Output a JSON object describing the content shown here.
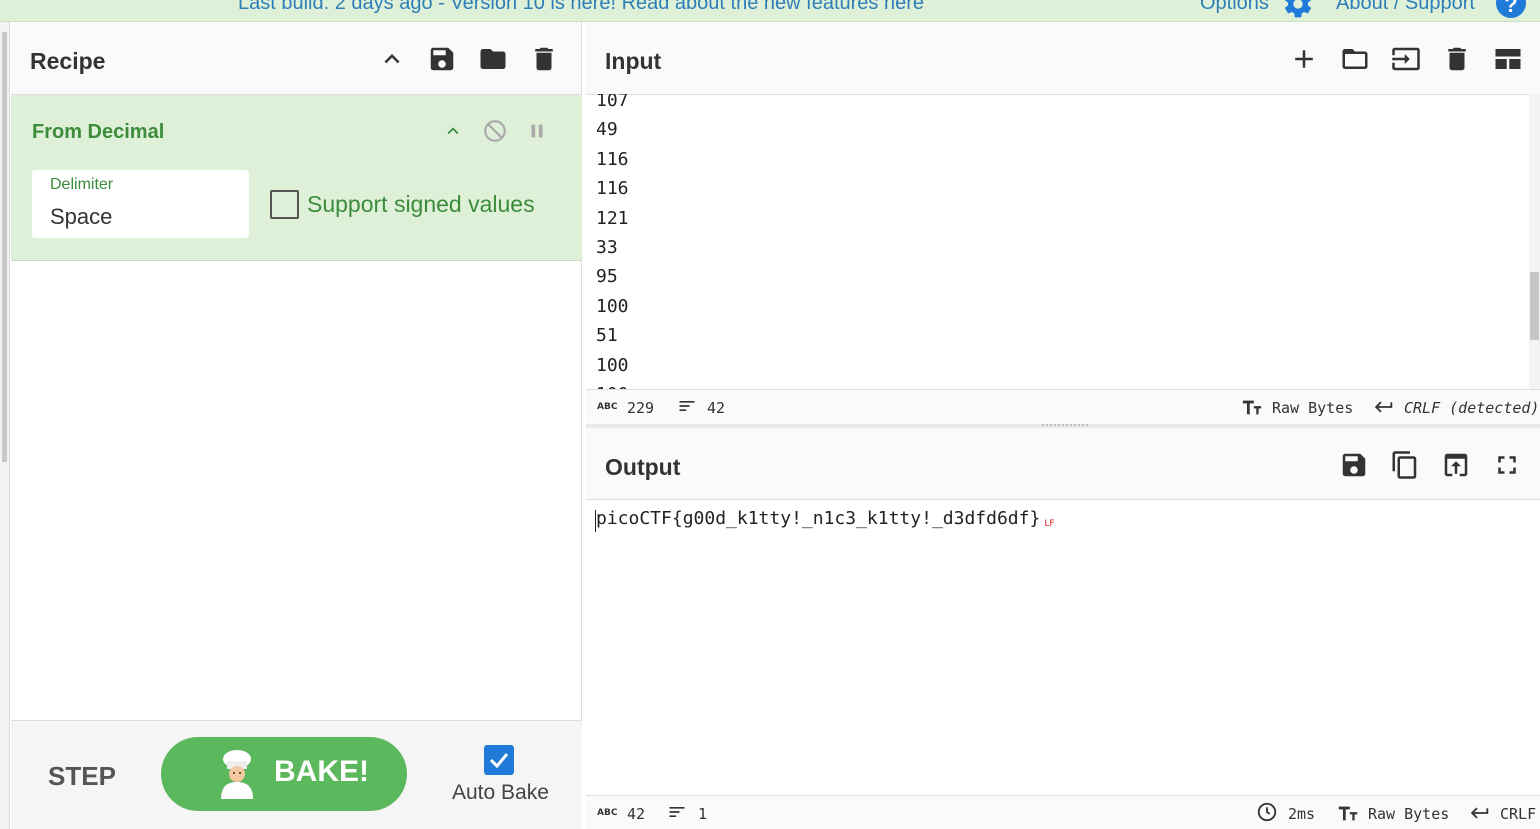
{
  "banner": {
    "message": "Last build: 2 days ago - Version 10 is here! Read about the new features ",
    "link": "here",
    "options": "Options",
    "about": "About / Support",
    "help_glyph": "?"
  },
  "recipe": {
    "title": "Recipe",
    "operation": {
      "name": "From Decimal",
      "delimiter_label": "Delimiter",
      "delimiter_value": "Space",
      "checkbox_label": "Support signed values"
    },
    "step_label": "STEP",
    "bake_label": "BAKE!",
    "autobake_label": "Auto Bake"
  },
  "input": {
    "title": "Input",
    "lines": [
      "107",
      "49",
      "116",
      "116",
      "121",
      "33",
      "95",
      "100",
      "51",
      "100",
      "100"
    ],
    "status": {
      "chars": "229",
      "lines": "42",
      "encoding": "Raw Bytes",
      "eol": "CRLF (detected)"
    }
  },
  "output": {
    "title": "Output",
    "text": "picoCTF{g00d_k1tty!_n1c3_k1tty!_d3dfd6df}",
    "eol_marker": "LF",
    "status": {
      "chars": "42",
      "lines": "1",
      "time": "2ms",
      "encoding": "Raw Bytes",
      "eol": "CRLF"
    }
  },
  "icons": [
    "gear-icon",
    "help-icon",
    "chevron-up-icon",
    "save-icon",
    "folder-icon",
    "trash-icon",
    "plus-icon",
    "import-icon",
    "layout-icon",
    "disable-icon",
    "pause-icon",
    "copy-icon",
    "replace-input-icon",
    "maximize-icon",
    "clock-icon",
    "text-encoding-icon",
    "line-ending-icon",
    "chef-icon",
    "checkbox-icon"
  ],
  "colors": {
    "accent_green": "#5cb85c",
    "op_bg": "#dff0d8",
    "link_blue": "#2e7fb8",
    "checkbox_blue": "#1f7ad8"
  }
}
